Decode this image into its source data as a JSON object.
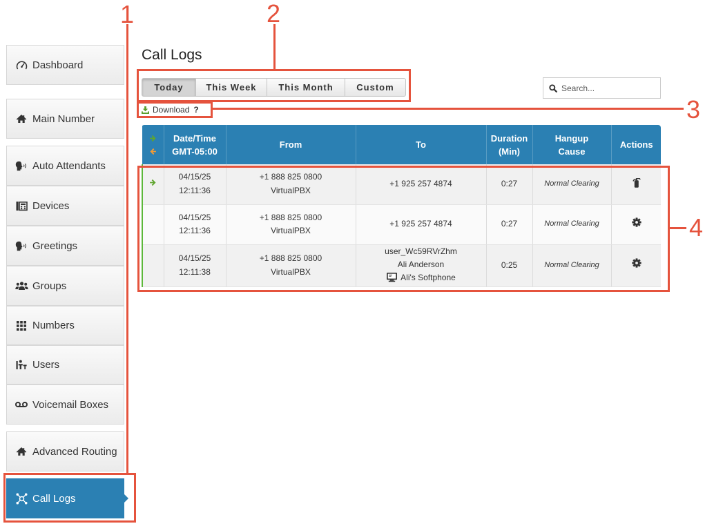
{
  "colors": {
    "accent": "#2b80b3",
    "annotation": "#e5533d",
    "inbound_arrow": "#5fa52e",
    "outbound_arrow": "#f29b35",
    "download_icon": "#5a9e2a",
    "row_indicator": "#5cb83a"
  },
  "annotations": {
    "label_1": "1",
    "label_2": "2",
    "label_3": "3",
    "label_4": "4"
  },
  "sidebar": {
    "items": [
      {
        "label": "Dashboard",
        "icon": "dashboard-gauge-icon"
      },
      {
        "label": "Main Number",
        "icon": "home-icon"
      },
      {
        "label": "Auto Attendants",
        "icon": "speaking-head-icon"
      },
      {
        "label": "Devices",
        "icon": "fax-device-icon"
      },
      {
        "label": "Greetings",
        "icon": "speaking-head-icon"
      },
      {
        "label": "Groups",
        "icon": "users-group-icon"
      },
      {
        "label": "Numbers",
        "icon": "grid-icon"
      },
      {
        "label": "Users",
        "icon": "user-desk-icon"
      },
      {
        "label": "Voicemail Boxes",
        "icon": "voicemail-icon"
      },
      {
        "label": "Advanced Routing",
        "icon": "home-icon"
      },
      {
        "label": "Call Logs",
        "icon": "network-icon",
        "active": true
      }
    ]
  },
  "page": {
    "title": "Call Logs"
  },
  "tabs": [
    {
      "label": "Today",
      "active": true
    },
    {
      "label": "This Week",
      "active": false
    },
    {
      "label": "This Month",
      "active": false
    },
    {
      "label": "Custom",
      "active": false
    }
  ],
  "search": {
    "placeholder": "Search...",
    "icon": "search-icon"
  },
  "download": {
    "label": "Download",
    "help": "?",
    "icon": "download-icon"
  },
  "table": {
    "header": {
      "direction_icons": [
        "inbound-arrow-icon",
        "outbound-arrow-icon"
      ],
      "datetime": [
        "Date/Time",
        "GMT-05:00"
      ],
      "from": "From",
      "to": "To",
      "duration": [
        "Duration",
        "(Min)"
      ],
      "hangup": [
        "Hangup",
        "Cause"
      ],
      "actions": "Actions"
    },
    "rows": [
      {
        "direction_icon": "inbound-arrow-icon",
        "date": "04/15/25",
        "time": "12:11:36",
        "from_number": "+1 888 825 0800",
        "from_name": "VirtualPBX",
        "to": [
          "+1 925 257 4874"
        ],
        "duration": "0:27",
        "hangup_cause": "Normal Clearing",
        "action_icon": "fire-extinguisher-icon"
      },
      {
        "date": "04/15/25",
        "time": "12:11:36",
        "from_number": "+1 888 825 0800",
        "from_name": "VirtualPBX",
        "to": [
          "+1 925 257 4874"
        ],
        "duration": "0:27",
        "hangup_cause": "Normal Clearing",
        "action_icon": "gear-icon"
      },
      {
        "date": "04/15/25",
        "time": "12:11:38",
        "from_number": "+1 888 825 0800",
        "from_name": "VirtualPBX",
        "to": [
          "user_Wc59RVrZhm",
          "Ali Anderson",
          "Ali's Softphone"
        ],
        "to_device_icon": "softphone-icon",
        "duration": "0:25",
        "hangup_cause": "Normal Clearing",
        "action_icon": "gear-icon"
      }
    ]
  }
}
